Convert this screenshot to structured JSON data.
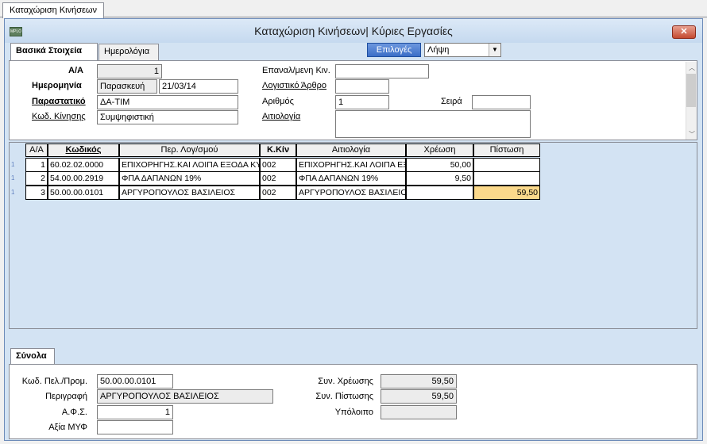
{
  "outer_tab": "Καταχώριση Κινήσεων",
  "window": {
    "title": "Καταχώριση Κινήσεων| Κύριες Εργασίες",
    "app_icon_text": "MPLO",
    "close_symbol": "✕"
  },
  "tabs": [
    "Βασικά Στοιχεία",
    "Ημερολόγια"
  ],
  "options_button": "Επιλογές",
  "mode_select": "Λήψη",
  "form": {
    "aa_label": "Α/Α",
    "aa_value": "1",
    "date_label": "Ημερομηνία",
    "day_value": "Παρασκευή",
    "date_value": "21/03/14",
    "document_label": "Παραστατικό",
    "document_value": "ΔΑ-ΤΙΜ",
    "movement_code_label": "Κωδ. Κίνησης",
    "movement_code_value": "Συμψηφιστική",
    "repeat_label": "Επαναλ/μενη Κιν.",
    "repeat_value": "",
    "accounting_article_label": "Λογιστικό Άρθρο",
    "accounting_article_value": "",
    "number_label": "Αριθμός",
    "number_value": "1",
    "series_label": "Σειρά",
    "series_value": "",
    "reason_label": "Αιτιολογία",
    "reason_value": ""
  },
  "grid": {
    "headers": [
      "Α/Α",
      "Κωδικός",
      "Περ. Λογ/σμού",
      "Κ.Κίν",
      "Αιτιολογία",
      "Χρέωση",
      "Πίστωση"
    ],
    "rows": [
      {
        "aa": "1",
        "code": "60.02.02.0000",
        "desc": "ΕΠΙΧΟΡΗΓΗΣ.ΚΑΙ ΛΟΙΠΑ ΕΞΟΔΑ ΚΥΛΙΚ",
        "kk": "002",
        "reason": "ΕΠΙΧΟΡΗΓΗΣ.ΚΑΙ ΛΟΙΠΑ ΕΞΟΔΑ",
        "debit": "50,00",
        "credit": ""
      },
      {
        "aa": "2",
        "code": "54.00.00.2919",
        "desc": "ΦΠΑ ΔΑΠΑΝΩΝ 19%",
        "kk": "002",
        "reason": "ΦΠΑ ΔΑΠΑΝΩΝ 19%",
        "debit": "9,50",
        "credit": ""
      },
      {
        "aa": "3",
        "code": "50.00.00.0101",
        "desc": "ΑΡΓΥΡΟΠΟΥΛΟΣ ΒΑΣΙΛΕΙΟΣ",
        "kk": "002",
        "reason": "ΑΡΓΥΡΟΠΟΥΛΟΣ ΒΑΣΙΛΕΙΟΣ",
        "debit": "",
        "credit": "59,50"
      }
    ],
    "row_indicator": "1"
  },
  "totals": {
    "tab": "Σύνολα",
    "customer_code_label": "Κωδ. Πελ./Προμ.",
    "customer_code_value": "50.00.00.0101",
    "description_label": "Περιγραφή",
    "description_value": "ΑΡΓΥΡΟΠΟΥΛΟΣ ΒΑΣΙΛΕΙΟΣ",
    "afm_label": "Α.Φ.Σ.",
    "afm_value": "1",
    "myf_label": "Αξία ΜΥΦ",
    "myf_value": "",
    "total_debit_label": "Συν. Χρέωσης",
    "total_debit_value": "59,50",
    "total_credit_label": "Συν. Πίστωσης",
    "total_credit_value": "59,50",
    "balance_label": "Υπόλοιπο",
    "balance_value": ""
  },
  "colors": {
    "highlight_cell": "#fbd98b",
    "options_button": "#3b6ec7",
    "window_bg": "#d3e3f3"
  }
}
